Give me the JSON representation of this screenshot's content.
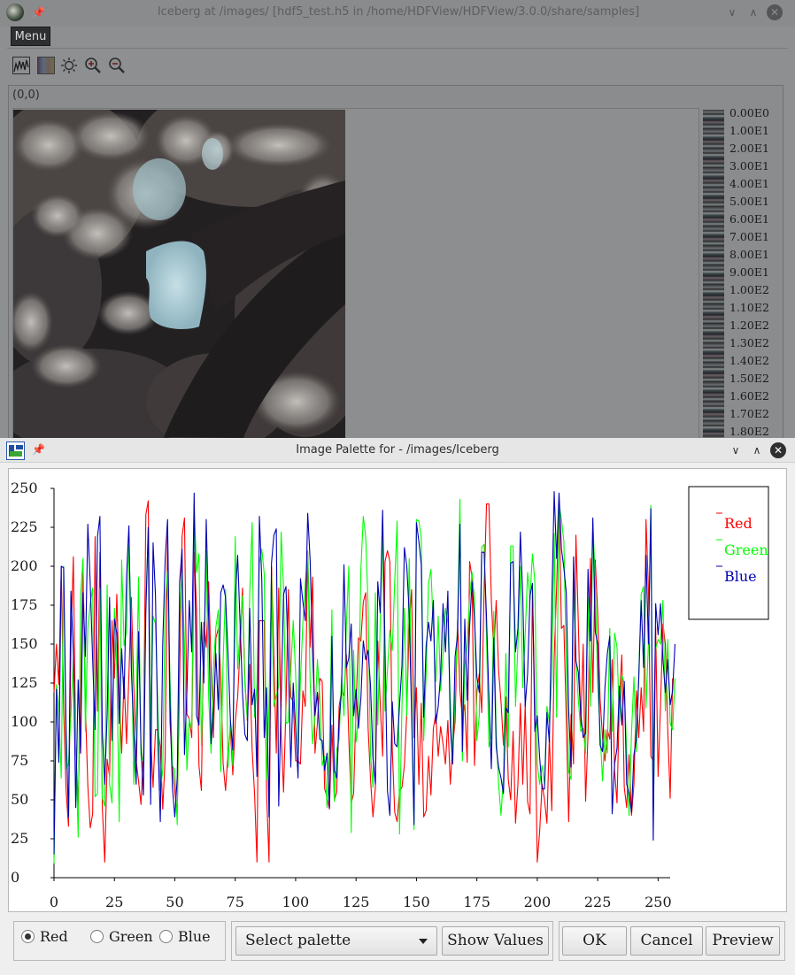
{
  "main_window": {
    "title": "Iceberg at /images/ [hdf5_test.h5 in /home/HDFView/HDFView/3.0.0/share/samples]",
    "menu_tooltip": "Menu",
    "coordinate": "(0,0)",
    "toolbar_icons": [
      "histogram-icon",
      "palette-icon",
      "brightness-icon",
      "zoom-in-icon",
      "zoom-out-icon"
    ],
    "palette_values": [
      "0.00E0",
      "1.00E1",
      "2.00E1",
      "3.00E1",
      "4.00E1",
      "5.00E1",
      "6.00E1",
      "7.00E1",
      "8.00E1",
      "9.00E1",
      "1.00E2",
      "1.10E2",
      "1.20E2",
      "1.30E2",
      "1.40E2",
      "1.50E2",
      "1.60E2",
      "1.70E2",
      "1.80E2"
    ]
  },
  "dialog": {
    "title": "Image Palette for - /images/Iceberg",
    "radio": {
      "red": "Red",
      "green": "Green",
      "blue": "Blue",
      "selected": "Red"
    },
    "select_palette": "Select palette",
    "show_values": "Show Values",
    "ok": "OK",
    "cancel": "Cancel",
    "preview": "Preview"
  },
  "chart_data": {
    "type": "line",
    "xlim": [
      0,
      255
    ],
    "ylim": [
      0,
      250
    ],
    "x_ticks": [
      0,
      25,
      50,
      75,
      100,
      125,
      150,
      175,
      200,
      225,
      250
    ],
    "y_ticks": [
      0,
      25,
      50,
      75,
      100,
      125,
      150,
      175,
      200,
      225,
      250
    ],
    "legend_position": "top-right",
    "colors": {
      "Red": "#ff0000",
      "Green": "#00ff00",
      "Blue": "#0000b4"
    },
    "series": [
      {
        "name": "Red",
        "values": [
          119,
          150,
          124,
          199,
          108,
          56,
          33,
          150,
          206,
          83,
          47,
          112,
          203,
          110,
          59,
          32,
          41,
          219,
          107,
          209,
          45,
          10,
          76,
          65,
          165,
          128,
          182,
          120,
          80,
          129,
          86,
          130,
          180,
          124,
          75,
          62,
          47,
          81,
          233,
          242,
          91,
          58,
          95,
          95,
          84,
          44,
          77,
          220,
          100,
          72,
          55,
          42,
          129,
          219,
          231,
          105,
          102,
          90,
          209,
          173,
          72,
          56,
          164,
          148,
          190,
          135,
          90,
          154,
          160,
          130,
          73,
          56,
          80,
          95,
          66,
          100,
          116,
          147,
          186,
          127,
          101,
          137,
          82,
          54,
          10,
          165,
          165,
          165,
          53,
          10,
          200,
          142,
          80,
          186,
          93,
          55,
          110,
          185,
          116,
          113,
          75,
          75,
          73,
          120,
          110,
          209,
          148,
          193,
          80,
          99,
          128,
          126,
          57,
          52,
          44,
          98,
          50,
          55,
          110,
          120,
          117,
          143,
          90,
          48,
          54,
          110,
          154,
          152,
          177,
          183,
          96,
          63,
          39,
          58,
          152,
          112,
          78,
          203,
          210,
          203,
          82,
          42,
          36,
          56,
          58,
          72,
          106,
          162,
          185,
          90,
          122,
          60,
          112,
          39,
          43,
          78,
          53,
          96,
          105,
          78,
          97,
          86,
          73,
          101,
          60,
          85,
          100,
          165,
          120,
          103,
          111,
          74,
          203,
          193,
          72,
          119,
          131,
          106,
          186,
          240,
          240,
          178,
          145,
          178,
          133,
          113,
          85,
          116,
          63,
          50,
          94,
          35,
          60,
          112,
          60,
          111,
          49,
          41,
          184,
          110,
          10,
          30,
          60,
          50,
          35,
          91,
          43,
          141,
          186,
          241,
          160,
          162,
          102,
          36,
          105,
          73,
          220,
          163,
          97,
          150,
          49,
          92,
          205,
          119,
          204,
          170,
          115,
          90,
          75,
          95,
          89,
          140,
          69,
          48,
          115,
          143,
          58,
          45,
          79,
          40,
          60,
          120,
          90,
          122,
          94,
          230,
          185,
          78,
          75,
          161,
          65,
          110,
          163,
          150,
          95,
          51,
          128
        ]
      },
      {
        "name": "Green",
        "values": [
          9,
          124,
          108,
          64,
          200,
          70,
          73,
          105,
          140,
          85,
          26,
          181,
          205,
          94,
          160,
          176,
          186,
          52,
          54,
          186,
          51,
          46,
          188,
          60,
          48,
          173,
          135,
          36,
          204,
          149,
          158,
          213,
          161,
          60,
          106,
          193,
          78,
          75,
          176,
          221,
          93,
          168,
          163,
          108,
          56,
          69,
          175,
          197,
          128,
          72,
          69,
          34,
          169,
          196,
          150,
          69,
          102,
          95,
          241,
          196,
          208,
          85,
          137,
          210,
          116,
          80,
          135,
          161,
          172,
          68,
          140,
          185,
          71,
          101,
          72,
          219,
          134,
          159,
          181,
          124,
          102,
          183,
          228,
          103,
          124,
          202,
          211,
          195,
          63,
          112,
          194,
          110,
          117,
          123,
          222,
          186,
          99,
          100,
          133,
          165,
          131,
          80,
          127,
          164,
          189,
          210,
          126,
          86,
          104,
          140,
          116,
          72,
          78,
          45,
          83,
          172,
          49,
          82,
          89,
          129,
          104,
          162,
          200,
          29,
          146,
          87,
          103,
          198,
          232,
          219,
          174,
          79,
          58,
          183,
          98,
          163,
          225,
          107,
          133,
          159,
          146,
          190,
          229,
          28,
          110,
          173,
          104,
          205,
          117,
          31,
          230,
          229,
          218,
          88,
          131,
          189,
          198,
          160,
          126,
          168,
          120,
          144,
          173,
          164,
          115,
          78,
          117,
          164,
          243,
          75,
          136,
          150,
          180,
          196,
          179,
          88,
          104,
          212,
          214,
          154,
          84,
          91,
          171,
          92,
          60,
          40,
          65,
          144,
          84,
          213,
          213,
          110,
          150,
          200,
          122,
          156,
          196,
          179,
          208,
          190,
          73,
          60,
          72,
          60,
          110,
          100,
          128,
          221,
          103,
          240,
          230,
          216,
          139,
          68,
          63,
          186,
          140,
          114,
          94,
          96,
          80,
          180,
          110,
          229,
          190,
          125,
          94,
          62,
          95,
          80,
          160,
          94,
          157,
          148,
          100,
          130,
          125,
          80,
          40,
          93,
          129,
          81,
          130,
          182,
          187,
          109,
          151,
          239,
          40,
          147,
          153,
          150,
          178,
          107,
          153,
          99,
          95,
          128
        ]
      },
      {
        "name": "Blue",
        "values": [
          15,
          121,
          74,
          200,
          199,
          95,
          39,
          184,
          145,
          45,
          127,
          80,
          183,
          142,
          227,
          189,
          140,
          95,
          219,
          232,
          94,
          60,
          105,
          180,
          88,
          166,
          157,
          99,
          147,
          115,
          193,
          226,
          134,
          94,
          60,
          158,
          84,
          53,
          170,
          225,
          47,
          215,
          181,
          88,
          36,
          150,
          204,
          230,
          113,
          58,
          39,
          64,
          190,
          211,
          79,
          120,
          178,
          145,
          247,
          104,
          98,
          164,
          125,
          230,
          167,
          86,
          107,
          144,
          108,
          183,
          188,
          180,
          144,
          101,
          82,
          179,
          207,
          164,
          119,
          92,
          88,
          173,
          111,
          121,
          65,
          232,
          191,
          90,
          122,
          39,
          202,
          220,
          224,
          46,
          114,
          182,
          187,
          137,
          71,
          125,
          96,
          64,
          192,
          177,
          165,
          234,
          204,
          145,
          104,
          119,
          89,
          88,
          69,
          80,
          45,
          155,
          69,
          64,
          101,
          120,
          201,
          135,
          141,
          163,
          104,
          121,
          96,
          115,
          152,
          140,
          146,
          123,
          77,
          60,
          190,
          170,
          236,
          146,
          56,
          40,
          113,
          86,
          84,
          111,
          136,
          212,
          200,
          170,
          105,
          34,
          228,
          216,
          201,
          103,
          149,
          164,
          152,
          178,
          99,
          110,
          130,
          176,
          145,
          184,
          97,
          73,
          142,
          156,
          227,
          81,
          166,
          114,
          161,
          190,
          167,
          129,
          119,
          209,
          209,
          167,
          115,
          70,
          154,
          84,
          71,
          64,
          54,
          109,
          106,
          202,
          203,
          145,
          160,
          222,
          180,
          110,
          131,
          181,
          189,
          94,
          104,
          77,
          57,
          57,
          106,
          87,
          175,
          248,
          205,
          247,
          211,
          199,
          183,
          107,
          71,
          206,
          139,
          132,
          105,
          90,
          93,
          198,
          152,
          231,
          158,
          150,
          85,
          81,
          122,
          144,
          155,
          41,
          73,
          83,
          123,
          98,
          126,
          60,
          54,
          42,
          79,
          89,
          128,
          178,
          135,
          207,
          150,
          237,
          24,
          176,
          156,
          176,
          140,
          119,
          140,
          111,
          120,
          150
        ]
      }
    ]
  }
}
